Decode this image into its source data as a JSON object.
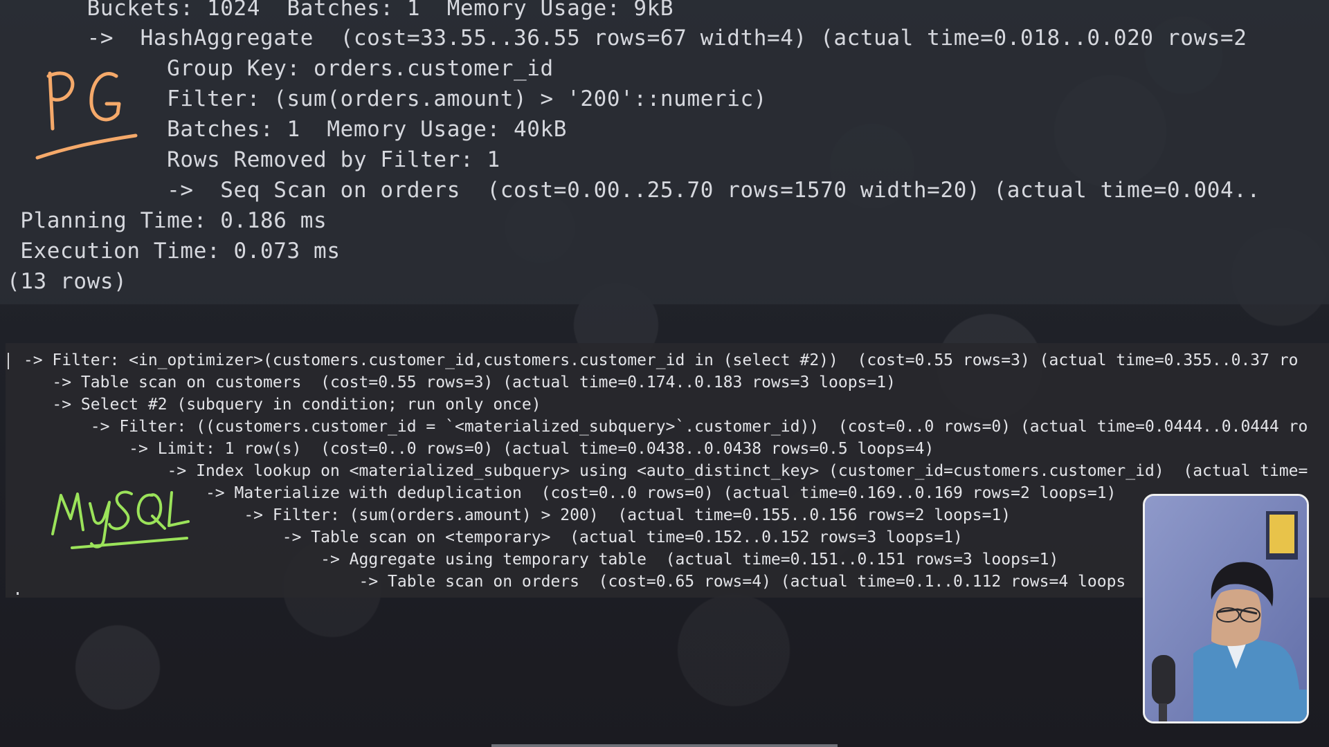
{
  "postgres_panel": {
    "lines": [
      "      Buckets: 1024  Batches: 1  Memory Usage: 9kB",
      "      ->  HashAggregate  (cost=33.55..36.55 rows=67 width=4) (actual time=0.018..0.020 rows=2",
      "            Group Key: orders.customer_id",
      "            Filter: (sum(orders.amount) > '200'::numeric)",
      "            Batches: 1  Memory Usage: 40kB",
      "            Rows Removed by Filter: 1",
      "            ->  Seq Scan on orders  (cost=0.00..25.70 rows=1570 width=20) (actual time=0.004..",
      " Planning Time: 0.186 ms",
      " Execution Time: 0.073 ms",
      "(13 rows)"
    ]
  },
  "mysql_panel": {
    "lines": [
      " -> Filter: <in_optimizer>(customers.customer_id,customers.customer_id in (select #2))  (cost=0.55 rows=3) (actual time=0.355..0.37 ro",
      "    -> Table scan on customers  (cost=0.55 rows=3) (actual time=0.174..0.183 rows=3 loops=1)",
      "    -> Select #2 (subquery in condition; run only once)",
      "        -> Filter: ((customers.customer_id = `<materialized_subquery>`.customer_id))  (cost=0..0 rows=0) (actual time=0.0444..0.0444 ro",
      "            -> Limit: 1 row(s)  (cost=0..0 rows=0) (actual time=0.0438..0.0438 rows=0.5 loops=4)",
      "                -> Index lookup on <materialized_subquery> using <auto_distinct_key> (customer_id=customers.customer_id)  (actual time=",
      "                    -> Materialize with deduplication  (cost=0..0 rows=0) (actual time=0.169..0.169 rows=2 loops=1)",
      "                        -> Filter: (sum(orders.amount) > 200)  (actual time=0.155..0.156 rows=2 loops=1)",
      "                            -> Table scan on <temporary>  (actual time=0.152..0.152 rows=3 loops=1)",
      "                                -> Aggregate using temporary table  (actual time=0.151..0.151 rows=3 loops=1)",
      "                                    -> Table scan on orders  (cost=0.65 rows=4) (actual time=0.1..0.112 rows=4 loops"
    ]
  },
  "annotations": {
    "pg_label": "PG",
    "pg_color": "#f5a96a",
    "mysql_label": "MySQL",
    "mysql_color": "#9be35a"
  },
  "webcam": {
    "background_color": "#7a86bd",
    "shirt_color": "#4f8fc4"
  }
}
